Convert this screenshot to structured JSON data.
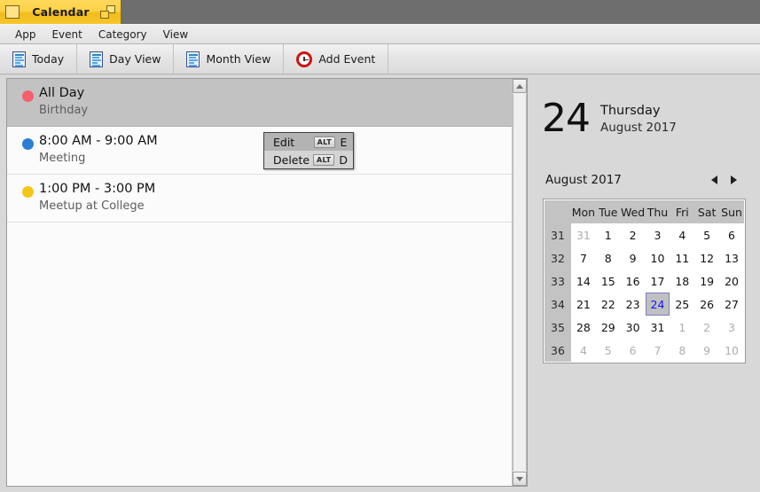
{
  "titlebar": {
    "app_title": "Calendar",
    "app_icon": "calendar-app-icon",
    "restore_icon": "restore-window-icon"
  },
  "menubar": {
    "items": [
      {
        "label": "App"
      },
      {
        "label": "Event"
      },
      {
        "label": "Category"
      },
      {
        "label": "View"
      }
    ]
  },
  "toolbar": {
    "buttons": [
      {
        "label": "Today",
        "icon": "document-icon"
      },
      {
        "label": "Day View",
        "icon": "document-icon"
      },
      {
        "label": "Month View",
        "icon": "document-icon"
      },
      {
        "label": "Add Event",
        "icon": "clock-icon"
      }
    ]
  },
  "event_list": {
    "events": [
      {
        "time": "All Day",
        "title": "Birthday",
        "color": "#f4606b",
        "selected": true
      },
      {
        "time": "8:00 AM - 9:00 AM",
        "title": "Meeting",
        "color": "#2a7fd4",
        "selected": false
      },
      {
        "time": "1:00 PM - 3:00 PM",
        "title": "Meetup at College",
        "color": "#f3c61e",
        "selected": false
      }
    ]
  },
  "context_menu": {
    "items": [
      {
        "label": "Edit",
        "modifier": "ALT",
        "key": "E",
        "highlighted": true
      },
      {
        "label": "Delete",
        "modifier": "ALT",
        "key": "D",
        "highlighted": false
      }
    ]
  },
  "right_panel": {
    "big_date": {
      "day_number": "24",
      "weekday": "Thursday",
      "month_year": "August 2017"
    },
    "calendar": {
      "header_label": "August 2017",
      "prev_label": "prev-month-arrow",
      "next_label": "next-month-arrow",
      "week_column_header": "",
      "day_headers": [
        "Mon",
        "Tue",
        "Wed",
        "Thu",
        "Fri",
        "Sat",
        "Sun"
      ],
      "weeks": [
        {
          "week_no": "31",
          "days": [
            {
              "n": "31",
              "out": true
            },
            {
              "n": "1"
            },
            {
              "n": "2"
            },
            {
              "n": "3"
            },
            {
              "n": "4"
            },
            {
              "n": "5"
            },
            {
              "n": "6"
            }
          ]
        },
        {
          "week_no": "32",
          "days": [
            {
              "n": "7"
            },
            {
              "n": "8"
            },
            {
              "n": "9"
            },
            {
              "n": "10"
            },
            {
              "n": "11"
            },
            {
              "n": "12"
            },
            {
              "n": "13"
            }
          ]
        },
        {
          "week_no": "33",
          "days": [
            {
              "n": "14"
            },
            {
              "n": "15"
            },
            {
              "n": "16"
            },
            {
              "n": "17"
            },
            {
              "n": "18"
            },
            {
              "n": "19"
            },
            {
              "n": "20"
            }
          ]
        },
        {
          "week_no": "34",
          "days": [
            {
              "n": "21"
            },
            {
              "n": "22"
            },
            {
              "n": "23"
            },
            {
              "n": "24",
              "selected": true
            },
            {
              "n": "25"
            },
            {
              "n": "26"
            },
            {
              "n": "27"
            }
          ]
        },
        {
          "week_no": "35",
          "days": [
            {
              "n": "28"
            },
            {
              "n": "29"
            },
            {
              "n": "30"
            },
            {
              "n": "31"
            },
            {
              "n": "1",
              "out": true
            },
            {
              "n": "2",
              "out": true
            },
            {
              "n": "3",
              "out": true
            }
          ]
        },
        {
          "week_no": "36",
          "days": [
            {
              "n": "4",
              "out": true
            },
            {
              "n": "5",
              "out": true
            },
            {
              "n": "6",
              "out": true
            },
            {
              "n": "7",
              "out": true
            },
            {
              "n": "8",
              "out": true
            },
            {
              "n": "9",
              "out": true
            },
            {
              "n": "10",
              "out": true
            }
          ]
        }
      ]
    }
  },
  "scrollbar": {
    "up_arrow": "scroll-up-arrow",
    "down_arrow": "scroll-down-arrow"
  },
  "colors": {
    "title_accent": "#fdd247",
    "selected_day_text": "#1414ff",
    "window_bg": "#d8d8d8"
  }
}
